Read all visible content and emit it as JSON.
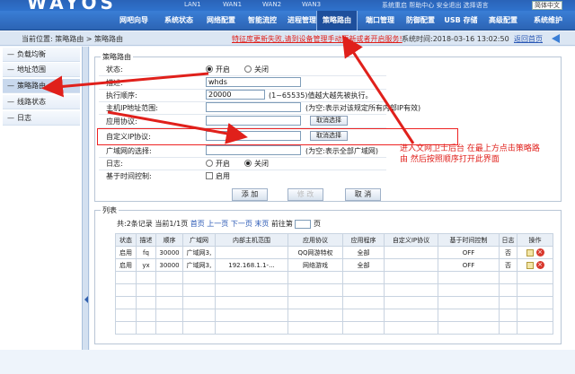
{
  "header": {
    "logo": "WAYOS",
    "lans": [
      "LAN1",
      "WAN1",
      "WAN2",
      "WAN3"
    ],
    "top_links": "系统重启  帮助中心  安全退出  选择语言",
    "lang_value": "简体中文"
  },
  "nav": [
    "网吧向导",
    "系统状态",
    "网络配置",
    "智能流控",
    "进程管理",
    "策略路由",
    "端口管理",
    "防御配置",
    "USB 存储",
    "高级配置",
    "系统维护"
  ],
  "crumb": "当前位置: 策略路由 > 策略路由",
  "notice": "特征库更新失败,请到设备管理手动更新或者开启服务!",
  "systime": "系统时间:2018-03-16 13:02:50",
  "back_link": "返回首页",
  "sidebar": [
    "负载均衡",
    "地址范围",
    "策略路由",
    "线路状态",
    "日志"
  ],
  "form": {
    "legend": "策略路由",
    "status_label": "状态:",
    "on": "开启",
    "off": "关闭",
    "desc_label": "描述:",
    "desc_value": "whds",
    "order_label": "执行顺序:",
    "order_value": "20000",
    "order_hint": "(1~65535)值越大越先被执行。",
    "host_label": "主机IP地址范围:",
    "host_hint": "(为空:表示对该规定所有内部IP有效)",
    "app_label": "应用协议:",
    "cancel_select": "取消选择",
    "custom_label": "自定义IP协议:",
    "wan_label": "广域网的选择:",
    "wan_hint": "(为空:表示全部广域网)",
    "log_label": "日志:",
    "log_on": "开启",
    "log_off": "关闭",
    "time_label": "基于时间控制:",
    "time_enable": "启用",
    "add_btn": "添 加",
    "modify_btn": "修 改",
    "cancel_btn": "取 消"
  },
  "annotation": "进入文网卫士后台 在最上方点击策略路由 然后按照顺序打开此界面",
  "list": {
    "legend": "列表",
    "summary": "共:2条记录 当前1/1页",
    "first": "首页",
    "prev": "上一页",
    "next": "下一页",
    "last": "末页",
    "goto": "前往第",
    "page_unit": "页",
    "headers": [
      "状态",
      "描述",
      "顺序",
      "广域网",
      "内部主机范围",
      "应用协议",
      "应用程序",
      "自定义IP协议",
      "基于时间控制",
      "日志",
      "操作"
    ],
    "rows": [
      [
        "启用",
        "fq",
        "30000",
        "广域网3,",
        "",
        "QQ网游特权",
        "全部",
        "",
        "OFF",
        "否"
      ],
      [
        "启用",
        "yx",
        "30000",
        "广域网3,",
        "192.168.1.1-...",
        "网络游戏",
        "全部",
        "",
        "OFF",
        "否"
      ]
    ]
  },
  "colors": {
    "nav": "#2f6fc6",
    "annotation": "#e0201b"
  }
}
